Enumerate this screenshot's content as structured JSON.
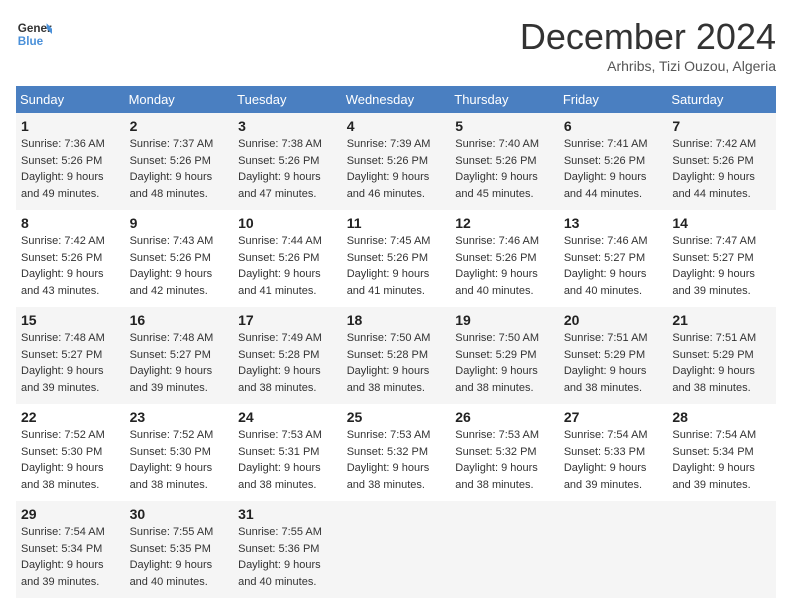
{
  "logo": {
    "line1": "General",
    "line2": "Blue"
  },
  "header": {
    "month": "December 2024",
    "location": "Arhribs, Tizi Ouzou, Algeria"
  },
  "columns": [
    "Sunday",
    "Monday",
    "Tuesday",
    "Wednesday",
    "Thursday",
    "Friday",
    "Saturday"
  ],
  "weeks": [
    [
      {
        "day": "1",
        "sunrise": "7:36 AM",
        "sunset": "5:26 PM",
        "daylight": "9 hours and 49 minutes."
      },
      {
        "day": "2",
        "sunrise": "7:37 AM",
        "sunset": "5:26 PM",
        "daylight": "9 hours and 48 minutes."
      },
      {
        "day": "3",
        "sunrise": "7:38 AM",
        "sunset": "5:26 PM",
        "daylight": "9 hours and 47 minutes."
      },
      {
        "day": "4",
        "sunrise": "7:39 AM",
        "sunset": "5:26 PM",
        "daylight": "9 hours and 46 minutes."
      },
      {
        "day": "5",
        "sunrise": "7:40 AM",
        "sunset": "5:26 PM",
        "daylight": "9 hours and 45 minutes."
      },
      {
        "day": "6",
        "sunrise": "7:41 AM",
        "sunset": "5:26 PM",
        "daylight": "9 hours and 44 minutes."
      },
      {
        "day": "7",
        "sunrise": "7:42 AM",
        "sunset": "5:26 PM",
        "daylight": "9 hours and 44 minutes."
      }
    ],
    [
      {
        "day": "8",
        "sunrise": "7:42 AM",
        "sunset": "5:26 PM",
        "daylight": "9 hours and 43 minutes."
      },
      {
        "day": "9",
        "sunrise": "7:43 AM",
        "sunset": "5:26 PM",
        "daylight": "9 hours and 42 minutes."
      },
      {
        "day": "10",
        "sunrise": "7:44 AM",
        "sunset": "5:26 PM",
        "daylight": "9 hours and 41 minutes."
      },
      {
        "day": "11",
        "sunrise": "7:45 AM",
        "sunset": "5:26 PM",
        "daylight": "9 hours and 41 minutes."
      },
      {
        "day": "12",
        "sunrise": "7:46 AM",
        "sunset": "5:26 PM",
        "daylight": "9 hours and 40 minutes."
      },
      {
        "day": "13",
        "sunrise": "7:46 AM",
        "sunset": "5:27 PM",
        "daylight": "9 hours and 40 minutes."
      },
      {
        "day": "14",
        "sunrise": "7:47 AM",
        "sunset": "5:27 PM",
        "daylight": "9 hours and 39 minutes."
      }
    ],
    [
      {
        "day": "15",
        "sunrise": "7:48 AM",
        "sunset": "5:27 PM",
        "daylight": "9 hours and 39 minutes."
      },
      {
        "day": "16",
        "sunrise": "7:48 AM",
        "sunset": "5:27 PM",
        "daylight": "9 hours and 39 minutes."
      },
      {
        "day": "17",
        "sunrise": "7:49 AM",
        "sunset": "5:28 PM",
        "daylight": "9 hours and 38 minutes."
      },
      {
        "day": "18",
        "sunrise": "7:50 AM",
        "sunset": "5:28 PM",
        "daylight": "9 hours and 38 minutes."
      },
      {
        "day": "19",
        "sunrise": "7:50 AM",
        "sunset": "5:29 PM",
        "daylight": "9 hours and 38 minutes."
      },
      {
        "day": "20",
        "sunrise": "7:51 AM",
        "sunset": "5:29 PM",
        "daylight": "9 hours and 38 minutes."
      },
      {
        "day": "21",
        "sunrise": "7:51 AM",
        "sunset": "5:29 PM",
        "daylight": "9 hours and 38 minutes."
      }
    ],
    [
      {
        "day": "22",
        "sunrise": "7:52 AM",
        "sunset": "5:30 PM",
        "daylight": "9 hours and 38 minutes."
      },
      {
        "day": "23",
        "sunrise": "7:52 AM",
        "sunset": "5:30 PM",
        "daylight": "9 hours and 38 minutes."
      },
      {
        "day": "24",
        "sunrise": "7:53 AM",
        "sunset": "5:31 PM",
        "daylight": "9 hours and 38 minutes."
      },
      {
        "day": "25",
        "sunrise": "7:53 AM",
        "sunset": "5:32 PM",
        "daylight": "9 hours and 38 minutes."
      },
      {
        "day": "26",
        "sunrise": "7:53 AM",
        "sunset": "5:32 PM",
        "daylight": "9 hours and 38 minutes."
      },
      {
        "day": "27",
        "sunrise": "7:54 AM",
        "sunset": "5:33 PM",
        "daylight": "9 hours and 39 minutes."
      },
      {
        "day": "28",
        "sunrise": "7:54 AM",
        "sunset": "5:34 PM",
        "daylight": "9 hours and 39 minutes."
      }
    ],
    [
      {
        "day": "29",
        "sunrise": "7:54 AM",
        "sunset": "5:34 PM",
        "daylight": "9 hours and 39 minutes."
      },
      {
        "day": "30",
        "sunrise": "7:55 AM",
        "sunset": "5:35 PM",
        "daylight": "9 hours and 40 minutes."
      },
      {
        "day": "31",
        "sunrise": "7:55 AM",
        "sunset": "5:36 PM",
        "daylight": "9 hours and 40 minutes."
      },
      null,
      null,
      null,
      null
    ]
  ],
  "labels": {
    "sunrise": "Sunrise:",
    "sunset": "Sunset:",
    "daylight": "Daylight:"
  }
}
